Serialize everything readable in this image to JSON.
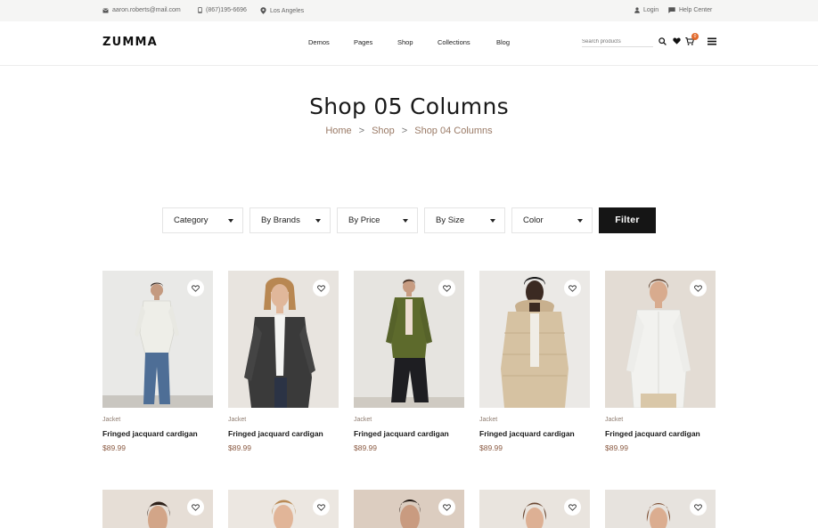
{
  "topbar": {
    "email": "aaron.roberts@mail.com",
    "phone": "(867)195-6696",
    "location": "Los Angeles",
    "login": "Login",
    "help": "Help Center"
  },
  "header": {
    "logo": "ZUMMA",
    "nav": [
      "Demos",
      "Pages",
      "Shop",
      "Collections",
      "Blog"
    ],
    "search_placeholder": "Search products",
    "cart_count": "0",
    "icons": [
      "search-icon",
      "heart-icon",
      "cart-icon",
      "menu-icon"
    ]
  },
  "hero": {
    "title": "Shop 05 Columns",
    "breadcrumb": [
      "Home",
      "Shop",
      "Shop 04 Columns"
    ],
    "separator": ">"
  },
  "filters": {
    "selects": [
      "Category",
      "By Brands",
      "By Price",
      "By Size",
      "Color"
    ],
    "button": "Filter"
  },
  "products": [
    {
      "category": "Jacket",
      "name": "Fringed jacquard cardigan",
      "price": "$89.99"
    },
    {
      "category": "Jacket",
      "name": "Fringed jacquard cardigan",
      "price": "$89.99"
    },
    {
      "category": "Jacket",
      "name": "Fringed jacquard cardigan",
      "price": "$89.99"
    },
    {
      "category": "Jacket",
      "name": "Fringed jacquard cardigan",
      "price": "$89.99"
    },
    {
      "category": "Jacket",
      "name": "Fringed jacquard cardigan",
      "price": "$89.99"
    }
  ],
  "colors": {
    "accent": "#9a7a66",
    "price": "#8a5a42",
    "badge": "#e26a2c",
    "button": "#151515"
  }
}
